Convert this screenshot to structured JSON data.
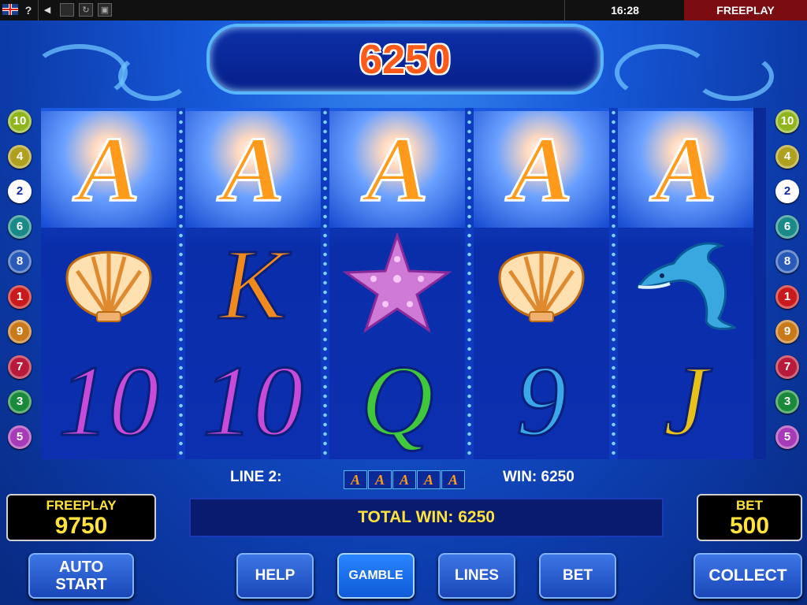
{
  "topbar": {
    "help_label": "?",
    "clock": "16:28",
    "mode": "FREEPLAY"
  },
  "display": {
    "win_value": "6250"
  },
  "reels": [
    [
      {
        "sym": "A",
        "kind": "a"
      },
      {
        "sym": "shell",
        "kind": "shell"
      },
      {
        "sym": "10",
        "kind": "letter",
        "color": "#c84ad8"
      }
    ],
    [
      {
        "sym": "A",
        "kind": "a"
      },
      {
        "sym": "K",
        "kind": "letter",
        "color": "#f08a1c"
      },
      {
        "sym": "10",
        "kind": "letter",
        "color": "#c84ad8"
      }
    ],
    [
      {
        "sym": "A",
        "kind": "a"
      },
      {
        "sym": "starfish",
        "kind": "star"
      },
      {
        "sym": "Q",
        "kind": "letter",
        "color": "#3ec83a"
      }
    ],
    [
      {
        "sym": "A",
        "kind": "a"
      },
      {
        "sym": "shell",
        "kind": "shell"
      },
      {
        "sym": "9",
        "kind": "letter",
        "color": "#3aa8e8"
      }
    ],
    [
      {
        "sym": "A",
        "kind": "a"
      },
      {
        "sym": "dolphin",
        "kind": "dolphin"
      },
      {
        "sym": "J",
        "kind": "letter",
        "color": "#e8c01a"
      }
    ]
  ],
  "lines_left": [
    {
      "n": "10",
      "color": "#8fb41c"
    },
    {
      "n": "4",
      "color": "#b0a020"
    },
    {
      "n": "2",
      "color": "#ffffff"
    },
    {
      "n": "6",
      "color": "#1a8a88"
    },
    {
      "n": "8",
      "color": "#2a5ab8"
    },
    {
      "n": "1",
      "color": "#c81a1a"
    },
    {
      "n": "9",
      "color": "#c87a1a"
    },
    {
      "n": "7",
      "color": "#b81a3a"
    },
    {
      "n": "3",
      "color": "#1a8a3a"
    },
    {
      "n": "5",
      "color": "#a83ab8"
    }
  ],
  "lines_right": [
    {
      "n": "10",
      "color": "#8fb41c"
    },
    {
      "n": "4",
      "color": "#b0a020"
    },
    {
      "n": "2",
      "color": "#ffffff"
    },
    {
      "n": "6",
      "color": "#1a8a88"
    },
    {
      "n": "8",
      "color": "#2a5ab8"
    },
    {
      "n": "1",
      "color": "#c81a1a"
    },
    {
      "n": "9",
      "color": "#c87a1a"
    },
    {
      "n": "7",
      "color": "#b81a3a"
    },
    {
      "n": "3",
      "color": "#1a8a3a"
    },
    {
      "n": "5",
      "color": "#a83ab8"
    }
  ],
  "info": {
    "line_label": "LINE 2:",
    "line_symbols": [
      "A",
      "A",
      "A",
      "A",
      "A"
    ],
    "win_label": "WIN: 6250"
  },
  "panels": {
    "credit_label": "FREEPLAY",
    "credit_value": "9750",
    "total_win": "TOTAL WIN: 6250",
    "bet_label": "BET",
    "bet_value": "500"
  },
  "buttons": {
    "auto_start": "AUTO\nSTART",
    "help": "HELP",
    "gamble": "GAMBLE",
    "lines": "LINES",
    "bet": "BET",
    "collect": "COLLECT"
  }
}
